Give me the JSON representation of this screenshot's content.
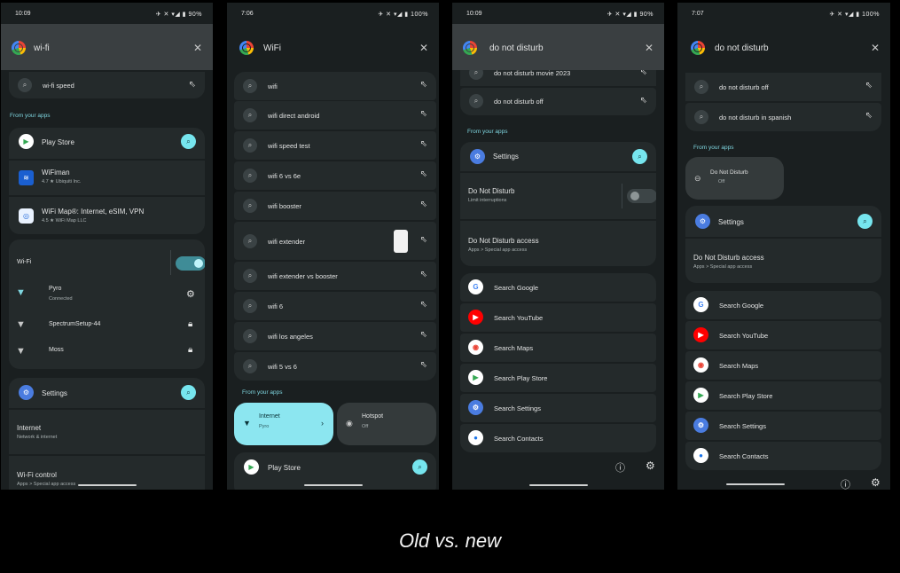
{
  "p1": {
    "time": "10:09",
    "status": "✈ ✕ ▾◢ ▮ 90%",
    "query": "wi-fi",
    "sugg": "wi-fi speed",
    "from_apps": "From your apps",
    "apps": [
      {
        "name": "Play Store",
        "sub": ""
      },
      {
        "name": "WiFiman",
        "sub": "4.7 ★ Ubiquiti Inc."
      },
      {
        "name": "WiFi Map®: Internet, eSIM, VPN",
        "sub": "4.5 ★ WiFi Map LLC"
      }
    ],
    "wifi_title": "Wi-Fi",
    "networks": [
      {
        "name": "Pyro",
        "sub": "Connected"
      },
      {
        "name": "SpectrumSetup-44",
        "sub": ""
      },
      {
        "name": "Moss",
        "sub": ""
      }
    ],
    "settings": "Settings",
    "internet": "Internet",
    "internet_sub": "Network & internet",
    "wfc": "Wi-Fi control",
    "wfc_sub": "Apps > Special app access"
  },
  "p2": {
    "time": "7:06",
    "status": "✈ ✕ ▾◢ ▮ 100%",
    "query": "WiFi",
    "suggestions": [
      "wifi",
      "wifi direct android",
      "wifi speed test",
      "wifi 6 vs 6e",
      "wifi booster",
      "wifi extender",
      "wifi extender vs booster",
      "wifi 6",
      "wifi los angeles",
      "wifi 5 vs 6"
    ],
    "from_apps": "From your apps",
    "internet": "Internet",
    "internet_sub": "Pyro",
    "hotspot": "Hotspot",
    "hotspot_sub": "Off",
    "play": "Play Store"
  },
  "p3": {
    "time": "10:09",
    "status": "✈ ✕ ▾◢ ▮ 90%",
    "query": "do not disturb",
    "suggestions": [
      "do not disturb movie 2023",
      "do not disturb off"
    ],
    "from_apps": "From your apps",
    "settings": "Settings",
    "dnd": "Do Not Disturb",
    "dnd_sub": "Limit interruptions",
    "dnd_access": "Do Not Disturb access",
    "dnd_access_sub": "Apps > Special app access",
    "searches": [
      "Search Google",
      "Search YouTube",
      "Search Maps",
      "Search Play Store",
      "Search Settings",
      "Search Contacts"
    ]
  },
  "p4": {
    "time": "7:07",
    "status": "✈ ✕ ▾◢ ▮ 100%",
    "query": "do not disturb",
    "suggestions": [
      "do not disturb off",
      "do not disturb in spanish"
    ],
    "from_apps": "From your apps",
    "chip": "Do Not Disturb",
    "chip_sub": "Off",
    "settings": "Settings",
    "dnd_access": "Do Not Disturb access",
    "dnd_access_sub": "Apps > Special app access",
    "searches": [
      "Search Google",
      "Search YouTube",
      "Search Maps",
      "Search Play Store",
      "Search Settings",
      "Search Contacts"
    ]
  },
  "caption": "Old vs. new",
  "colors": {
    "accent": "#76e5ee",
    "panel": "#242a2b",
    "bg": "#1a1f20"
  }
}
